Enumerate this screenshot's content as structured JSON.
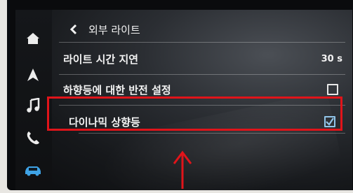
{
  "header": {
    "back_icon": "chevron-left-icon",
    "title": "외부 라이트"
  },
  "sidebar": {
    "items": [
      {
        "icon": "home-icon"
      },
      {
        "icon": "navigation-arrow-icon"
      },
      {
        "icon": "music-note-icon"
      },
      {
        "icon": "phone-icon"
      },
      {
        "icon": "car-icon",
        "active": true
      }
    ]
  },
  "settings": [
    {
      "label": "라이트 시간 지연",
      "value": "30 s"
    },
    {
      "label": "하향등에 대한 반전 설정",
      "checked": false
    },
    {
      "label": "다이나믹 상향등",
      "checked": true
    }
  ],
  "colors": {
    "highlight_border": "#e0141a",
    "active_icon": "#3fa3e6",
    "annotation_arrow": "#e0141a"
  }
}
